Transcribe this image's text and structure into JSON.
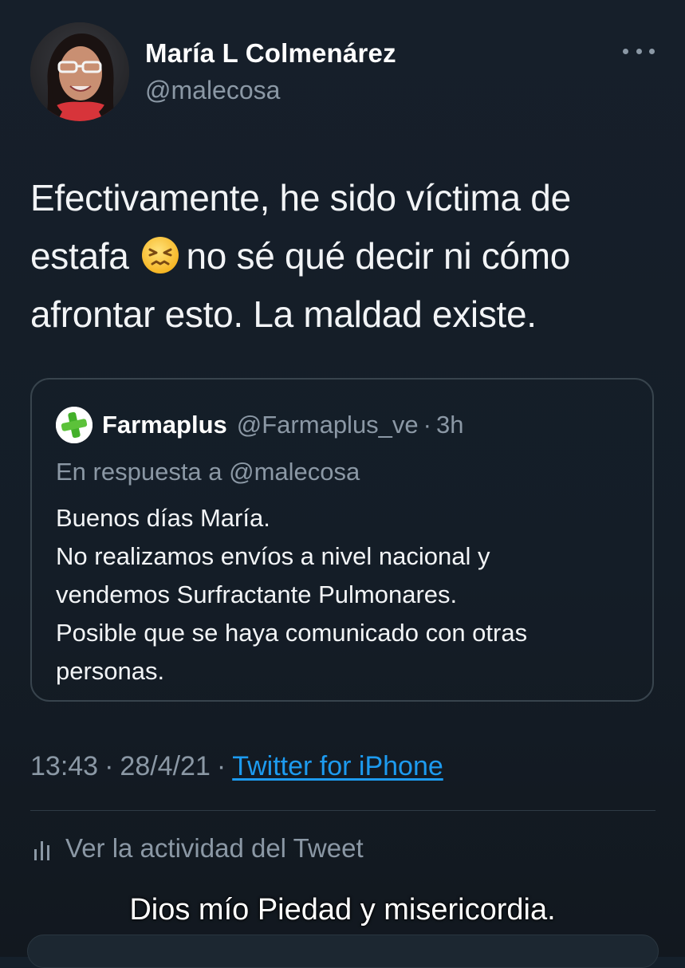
{
  "tweet": {
    "author_name": "María L Colmenárez",
    "author_handle": "@malecosa",
    "text_lines": [
      "Efectivamente, he sido víctima de",
      "estafa",
      "no sé qué decir ni cómo",
      "afrontar esto. La maldad existe."
    ],
    "emoji_icon": "persevering-face-icon",
    "timestamp_time": "13:43",
    "timestamp_date": "28/4/21",
    "separator": "·",
    "source": "Twitter for iPhone",
    "activity_label": "Ver la actividad del Tweet"
  },
  "quoted": {
    "name": "Farmaplus",
    "handle": "@Farmaplus_ve",
    "dot": "·",
    "time": "3h",
    "reply_to": "En respuesta a @malecosa",
    "body_lines": [
      "Buenos días María.",
      "No realizamos envíos a nivel nacional y",
      "vendemos Surfractante Pulmonares.",
      "Posible que se haya comunicado con otras",
      "personas."
    ],
    "logo_icon": "green-cross-logo-icon"
  },
  "caption": "Dios mío Piedad y misericordia.",
  "colors": {
    "background": "#15202b",
    "link": "#1d9bf0",
    "secondary_text": "#8b98a5",
    "brand_green": "#43b02a"
  }
}
